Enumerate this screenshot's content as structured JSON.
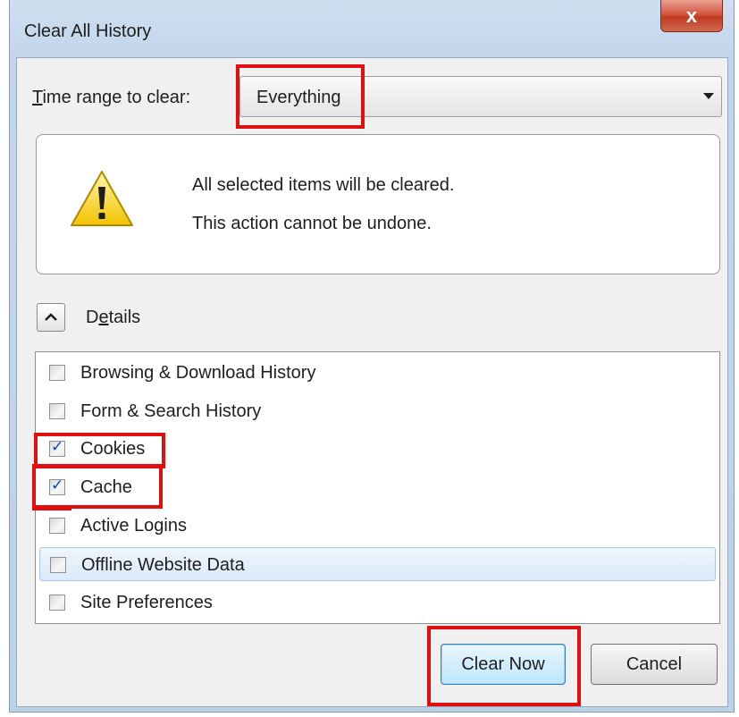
{
  "window": {
    "title": "Clear All History",
    "close_glyph": "x"
  },
  "time_range": {
    "label_prefix": "",
    "label_mnemonic": "T",
    "label_rest": "ime range to clear:",
    "selected": "Everything"
  },
  "warning": {
    "icon": "warning-triangle-icon",
    "line1": "All selected items will be cleared.",
    "line2": "This action cannot be undone."
  },
  "details": {
    "toggle_icon": "chevron-up-icon",
    "label_prefix": "D",
    "label_mnemonic": "e",
    "label_rest": "tails"
  },
  "items": [
    {
      "label": "Browsing & Download History",
      "checked": false
    },
    {
      "label": "Form & Search History",
      "checked": false
    },
    {
      "label": "Cookies",
      "checked": true
    },
    {
      "label": "Cache",
      "checked": true
    },
    {
      "label": "Active Logins",
      "checked": false
    },
    {
      "label": "Offline Website Data",
      "checked": false
    },
    {
      "label": "Site Preferences",
      "checked": false
    }
  ],
  "buttons": {
    "clear_now": "Clear Now",
    "cancel": "Cancel"
  },
  "colors": {
    "highlight": "#e01010",
    "check": "#1a3fb5"
  }
}
